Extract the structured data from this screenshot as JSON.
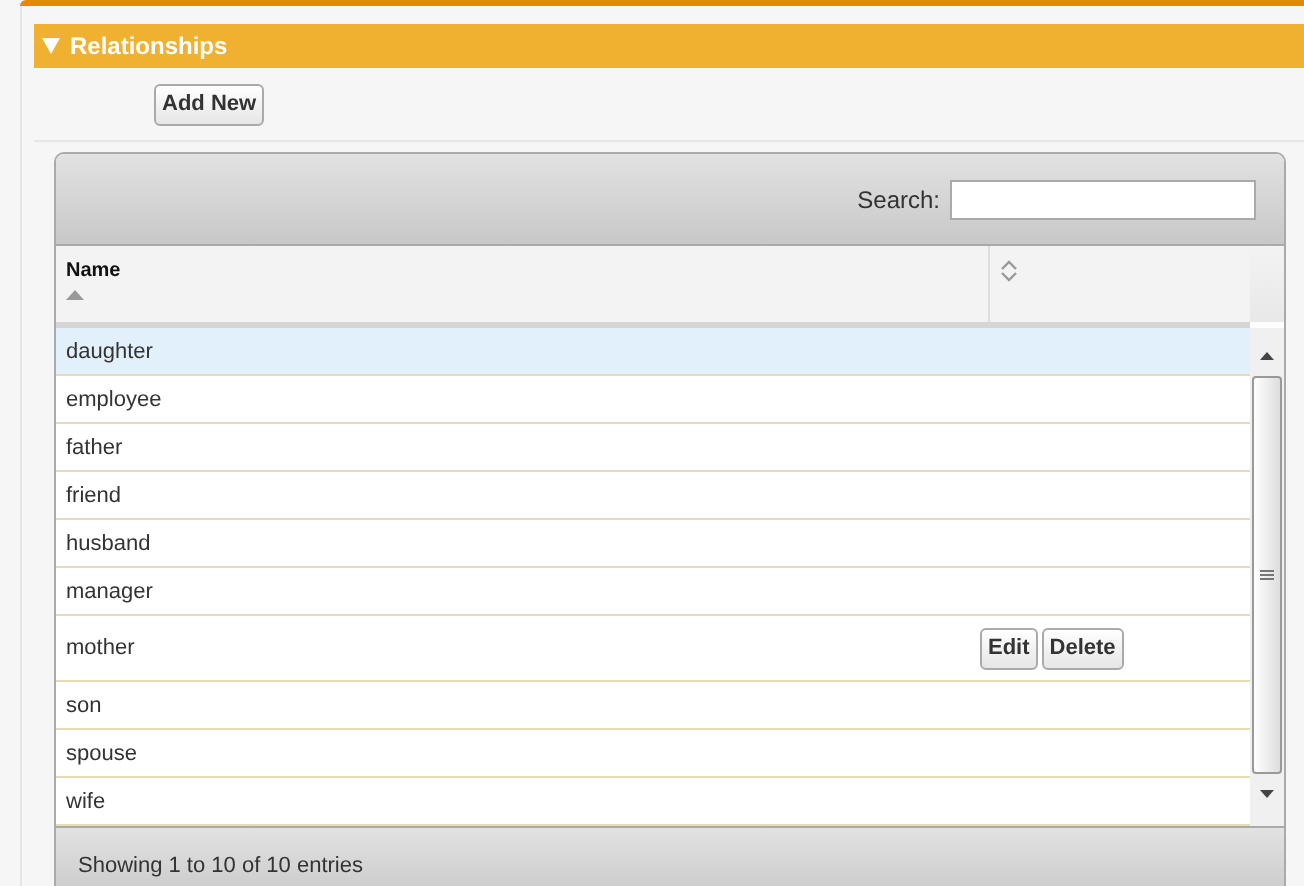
{
  "section": {
    "title": "Relationships",
    "expanded": true
  },
  "add_button": "Add New",
  "search": {
    "label": "Search:"
  },
  "table": {
    "columns": [
      {
        "label": "Name",
        "sorted": true
      },
      {
        "sorted": false
      }
    ],
    "rows": [
      {
        "name": "daughter",
        "highlighted": true
      },
      {
        "name": "employee",
        "highlighted": false
      },
      {
        "name": "father",
        "highlighted": false
      },
      {
        "name": "friend",
        "highlighted": false
      },
      {
        "name": "husband",
        "highlighted": false
      },
      {
        "name": "manager",
        "highlighted": false
      },
      {
        "name": "mother",
        "highlighted": false,
        "actions": [
          "Edit",
          "Delete"
        ]
      },
      {
        "name": "son",
        "highlighted": false
      },
      {
        "name": "spouse",
        "highlighted": false
      },
      {
        "name": "wife",
        "highlighted": false
      }
    ]
  },
  "footer": "Showing 1 to 10 of 10 entries"
}
